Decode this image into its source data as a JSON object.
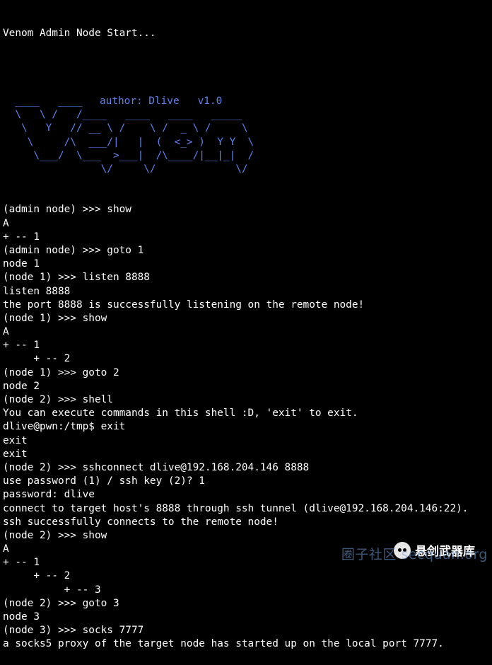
{
  "terminal": {
    "start_line": "Venom Admin Node Start...",
    "banner": {
      "author_text": "author: Dlive   v1.0",
      "art": "  ____   ____              \n  \\   \\ /   /____   ____   ____   _____\n   \\   Y   // __ \\ /    \\ /  _ \\ /     \\\n    \\     /\\  ___/|   |  (  <_> )  Y Y  \\\n     \\___/  \\___  >___|  /\\____/|__|_|  /\n                \\/     \\/             \\/"
    },
    "lines": [
      "(admin node) >>> show",
      "A",
      "+ -- 1",
      "(admin node) >>> goto 1",
      "node 1",
      "(node 1) >>> listen 8888",
      "listen 8888",
      "the port 8888 is successfully listening on the remote node!",
      "(node 1) >>> show",
      "A",
      "+ -- 1",
      "     + -- 2",
      "(node 1) >>> goto 2",
      "node 2",
      "(node 2) >>> shell",
      "You can execute commands in this shell :D, 'exit' to exit.",
      "dlive@pwn:/tmp$ exit",
      "exit",
      "exit",
      "(node 2) >>> sshconnect dlive@192.168.204.146 8888",
      "use password (1) / ssh key (2)? 1",
      "password: dlive",
      "connect to target host's 8888 through ssh tunnel (dlive@192.168.204.146:22).",
      "ssh successfully connects to the remote node!",
      "(node 2) >>> show",
      "A",
      "+ -- 1",
      "     + -- 2",
      "          + -- 3",
      "(node 2) >>> goto 3",
      "node 3",
      "(node 3) >>> socks 7777",
      "a socks5 proxy of the target node has started up on the local port 7777."
    ]
  },
  "watermark": {
    "title": "悬剑武器库",
    "site": "圈子社区 secquan.org",
    "icon": "wechat-icon"
  },
  "colors": {
    "background": "#000000",
    "text": "#ffffff",
    "banner": "#5f82ee"
  }
}
